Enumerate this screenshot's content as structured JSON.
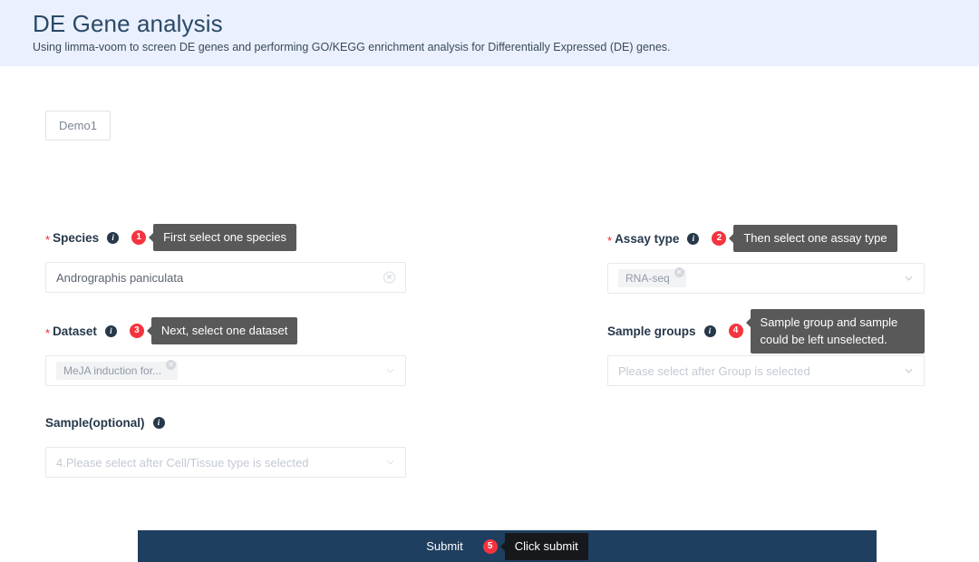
{
  "header": {
    "title": "DE Gene analysis",
    "subtitle": "Using limma-voom to screen DE genes and performing GO/KEGG enrichment analysis for Differentially Expressed (DE) genes.",
    "background_color": "#eaf0fd"
  },
  "demo": {
    "label": "Demo1"
  },
  "colors": {
    "required_star": "#f5222d",
    "step_badge": "#f5333f",
    "tooltip": "#595959",
    "tooltip_dark": "#16181c",
    "submit_bar": "#1e3f5f",
    "label_text": "#26384a"
  },
  "fields": {
    "species": {
      "required": true,
      "star": "*",
      "label": "Species",
      "info_icon": "info-icon",
      "step": "1",
      "tooltip": "First select one species",
      "value": "Andrographis paniculata",
      "clear_icon": "clear-circle-icon"
    },
    "assay_type": {
      "required": true,
      "star": "*",
      "label": "Assay type",
      "info_icon": "info-icon",
      "step": "2",
      "tooltip": "Then select one assay type",
      "chip": "RNA-seq",
      "chip_close_icon": "close-icon",
      "chevron_icon": "chevron-down-icon"
    },
    "dataset": {
      "required": true,
      "star": "*",
      "label": "Dataset",
      "info_icon": "info-icon",
      "step": "3",
      "tooltip": "Next, select one dataset",
      "chip": "MeJA induction for...",
      "chip_close_icon": "close-icon",
      "chevron_icon": "chevron-down-icon"
    },
    "sample_groups": {
      "required": false,
      "label": "Sample groups",
      "info_icon": "info-icon",
      "step": "4",
      "tooltip": "Sample group and sample could be left unselected.",
      "placeholder": "Please select after Group is selected",
      "chevron_icon": "chevron-down-icon"
    },
    "sample": {
      "required": false,
      "label": "Sample(optional)",
      "info_icon": "info-icon",
      "placeholder": "4.Please select after Cell/Tissue type is selected",
      "chevron_icon": "chevron-down-icon"
    }
  },
  "submit": {
    "label": "Submit",
    "step": "5",
    "tooltip": "Click submit"
  }
}
